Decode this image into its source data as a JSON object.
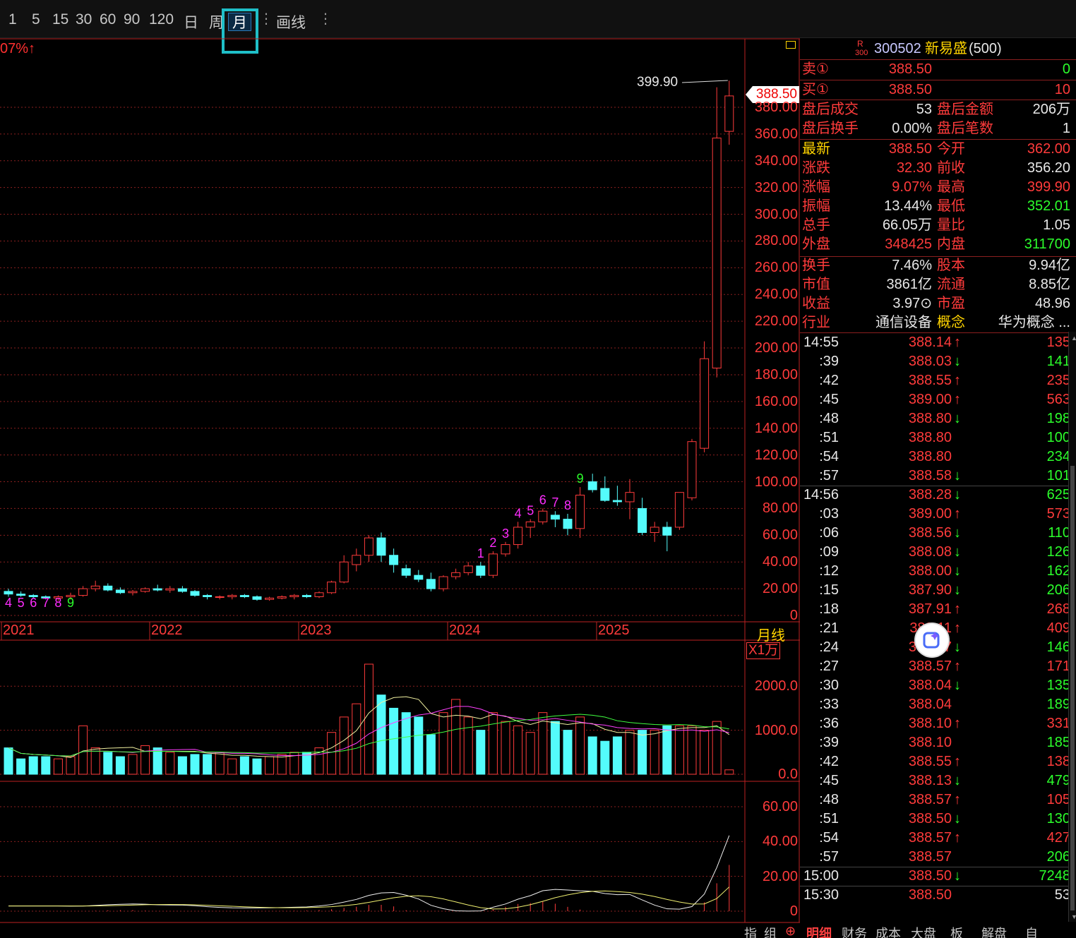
{
  "toolbar": {
    "periods": [
      "1",
      "5",
      "15",
      "30",
      "60",
      "90",
      "120",
      "日",
      "周",
      "月"
    ],
    "active": "月",
    "draw_label": "画线"
  },
  "chart_data": {
    "type": "candlestick",
    "period": "月线",
    "pct_label": "07%↑",
    "price_axis": [
      "380.00",
      "360.00",
      "340.00",
      "320.00",
      "300.00",
      "280.00",
      "260.00",
      "240.00",
      "220.00",
      "200.00",
      "180.00",
      "160.00",
      "140.00",
      "120.00",
      "100.00",
      "80.00",
      "60.00",
      "40.00",
      "20.00",
      "0"
    ],
    "ylim": [
      0,
      390
    ],
    "years": [
      "2021",
      "2022",
      "2023",
      "2024",
      "2025"
    ],
    "peak_label": "399.90",
    "last_price_tag": "388.50",
    "candles": [
      [
        18,
        20,
        14,
        16
      ],
      [
        16,
        18,
        14,
        15
      ],
      [
        15,
        16,
        13,
        14
      ],
      [
        14,
        15,
        12,
        13
      ],
      [
        13,
        15,
        11,
        14
      ],
      [
        14,
        17,
        12,
        15
      ],
      [
        15,
        22,
        14,
        20
      ],
      [
        20,
        26,
        18,
        22
      ],
      [
        22,
        24,
        18,
        19
      ],
      [
        19,
        21,
        16,
        17
      ],
      [
        17,
        19,
        15,
        18
      ],
      [
        18,
        21,
        17,
        20
      ],
      [
        20,
        23,
        18,
        19
      ],
      [
        19,
        22,
        17,
        20
      ],
      [
        20,
        22,
        17,
        18
      ],
      [
        18,
        19,
        14,
        15
      ],
      [
        15,
        16,
        12,
        14
      ],
      [
        14,
        15,
        12,
        14
      ],
      [
        14,
        16,
        12,
        15
      ],
      [
        15,
        16,
        13,
        14
      ],
      [
        14,
        15,
        11,
        12
      ],
      [
        12,
        14,
        11,
        13
      ],
      [
        13,
        15,
        12,
        14
      ],
      [
        14,
        16,
        12,
        15
      ],
      [
        15,
        16,
        13,
        14
      ],
      [
        14,
        18,
        13,
        17
      ],
      [
        17,
        26,
        16,
        25
      ],
      [
        25,
        45,
        24,
        40
      ],
      [
        38,
        50,
        33,
        45
      ],
      [
        45,
        60,
        40,
        58
      ],
      [
        58,
        62,
        40,
        45
      ],
      [
        45,
        50,
        32,
        38
      ],
      [
        35,
        38,
        28,
        30
      ],
      [
        30,
        34,
        25,
        27
      ],
      [
        27,
        32,
        18,
        20
      ],
      [
        20,
        30,
        18,
        29
      ],
      [
        29,
        35,
        27,
        32
      ],
      [
        32,
        40,
        30,
        37
      ],
      [
        37,
        40,
        28,
        30
      ],
      [
        30,
        48,
        28,
        46
      ],
      [
        46,
        55,
        44,
        53
      ],
      [
        53,
        70,
        50,
        66
      ],
      [
        66,
        72,
        58,
        70
      ],
      [
        70,
        80,
        68,
        78
      ],
      [
        75,
        78,
        66,
        72
      ],
      [
        72,
        76,
        60,
        65
      ],
      [
        65,
        96,
        58,
        90
      ],
      [
        100,
        106,
        92,
        94
      ],
      [
        95,
        104,
        85,
        86
      ],
      [
        86,
        97,
        82,
        85
      ],
      [
        85,
        102,
        72,
        92
      ],
      [
        80,
        88,
        60,
        62
      ],
      [
        62,
        70,
        55,
        66
      ],
      [
        66,
        70,
        48,
        60
      ],
      [
        66,
        92,
        64,
        92
      ],
      [
        88,
        132,
        86,
        130
      ],
      [
        125,
        205,
        122,
        192
      ],
      [
        185,
        395,
        178,
        357
      ],
      [
        362,
        399.9,
        352.01,
        388.5
      ]
    ],
    "td_labels": [
      {
        "i": 0,
        "t": "4",
        "c": "#ff2cff"
      },
      {
        "i": 1,
        "t": "5",
        "c": "#ff2cff"
      },
      {
        "i": 2,
        "t": "6",
        "c": "#ff2cff"
      },
      {
        "i": 3,
        "t": "7",
        "c": "#ff2cff"
      },
      {
        "i": 4,
        "t": "8",
        "c": "#ff2cff"
      },
      {
        "i": 5,
        "t": "9",
        "c": "#2cff2c"
      },
      {
        "i": 38,
        "t": "1",
        "c": "#ff2cff"
      },
      {
        "i": 39,
        "t": "2",
        "c": "#ff2cff"
      },
      {
        "i": 40,
        "t": "3",
        "c": "#ff2cff"
      },
      {
        "i": 41,
        "t": "4",
        "c": "#ff2cff"
      },
      {
        "i": 42,
        "t": "5",
        "c": "#ff2cff"
      },
      {
        "i": 43,
        "t": "6",
        "c": "#ff2cff"
      },
      {
        "i": 44,
        "t": "7",
        "c": "#ff2cff"
      },
      {
        "i": 45,
        "t": "8",
        "c": "#ff2cff"
      },
      {
        "i": 46,
        "t": "9",
        "c": "#2cff2c"
      }
    ],
    "volume_axis": [
      "2000.0",
      "1000.0",
      "0.0"
    ],
    "volume_unit": "X1万",
    "volume": [
      600,
      350,
      400,
      400,
      350,
      400,
      1100,
      600,
      500,
      400,
      450,
      650,
      600,
      500,
      400,
      450,
      450,
      500,
      350,
      400,
      350,
      400,
      450,
      500,
      500,
      600,
      950,
      1300,
      1600,
      2500,
      1800,
      1500,
      1400,
      1300,
      900,
      1400,
      1700,
      1300,
      1000,
      1400,
      1200,
      1100,
      950,
      1400,
      1200,
      1000,
      1300,
      850,
      750,
      850,
      1000,
      1000,
      1000,
      1100,
      1100,
      1100,
      1000,
      1200,
      100
    ],
    "indicator_axis": [
      "60.00",
      "40.00",
      "20.00",
      "0"
    ]
  },
  "quote": {
    "board_tag": "R",
    "board_tag2": "300",
    "code": "300502",
    "name": "新易盛",
    "index": "(500)",
    "sell_label": "卖①",
    "sell_price": "388.50",
    "sell_vol": "0",
    "buy_label": "买①",
    "buy_price": "388.50",
    "buy_vol": "10",
    "after_vol_label": "盘后成交",
    "after_vol": "53",
    "after_amt_label": "盘后金额",
    "after_amt": "206万",
    "after_turn_label": "盘后换手",
    "after_turn": "0.00%",
    "after_cnt_label": "盘后笔数",
    "after_cnt": "1",
    "stats": [
      {
        "l": "最新",
        "lc": "#ffd400",
        "v": "388.50",
        "vc": "#ff3b3b",
        "l2": "今开",
        "v2": "362.00",
        "v2c": "#ff3b3b"
      },
      {
        "l": "涨跌",
        "lc": "#ff3b3b",
        "v": "32.30",
        "vc": "#ff3b3b",
        "l2": "前收",
        "v2": "356.20",
        "v2c": "#e8e8e8"
      },
      {
        "l": "涨幅",
        "lc": "#ff3b3b",
        "v": "9.07%",
        "vc": "#ff3b3b",
        "l2": "最高",
        "v2": "399.90",
        "v2c": "#ff3b3b"
      },
      {
        "l": "振幅",
        "lc": "#ff3b3b",
        "v": "13.44%",
        "vc": "#e8e8e8",
        "l2": "最低",
        "v2": "352.01",
        "v2c": "#2cff2c"
      },
      {
        "l": "总手",
        "lc": "#ff3b3b",
        "v": "66.05万",
        "vc": "#e8e8e8",
        "l2": "量比",
        "v2": "1.05",
        "v2c": "#e8e8e8"
      },
      {
        "l": "外盘",
        "lc": "#ff3b3b",
        "v": "348425",
        "vc": "#ff3b3b",
        "l2": "内盘",
        "v2": "311700",
        "v2c": "#2cff2c"
      }
    ],
    "stats2": [
      {
        "l": "换手",
        "v": "7.46%",
        "l2": "股本",
        "v2": "9.94亿"
      },
      {
        "l": "市值",
        "v": "3861亿",
        "l2": "流通",
        "v2": "8.85亿"
      },
      {
        "l": "收益",
        "v": "3.97⊙",
        "l2": "市盈",
        "v2": "48.96"
      }
    ],
    "industry_label": "行业",
    "industry": "通信设备",
    "concept_label": "概念",
    "concept": "华为概念 ..."
  },
  "ticks": [
    {
      "t": "14:55",
      "p": "388.14",
      "d": "up",
      "v": "135"
    },
    {
      "t": ":39",
      "p": "388.03",
      "d": "down",
      "v": "141"
    },
    {
      "t": ":42",
      "p": "388.55",
      "d": "up",
      "v": "235"
    },
    {
      "t": ":45",
      "p": "389.00",
      "d": "up",
      "v": "563"
    },
    {
      "t": ":48",
      "p": "388.80",
      "d": "down",
      "v": "198"
    },
    {
      "t": ":51",
      "p": "388.80",
      "d": "",
      "v": "100"
    },
    {
      "t": ":54",
      "p": "388.80",
      "d": "",
      "v": "234"
    },
    {
      "t": ":57",
      "p": "388.58",
      "d": "down",
      "v": "101"
    },
    {
      "t": "14:56",
      "p": "388.28",
      "d": "down",
      "v": "625"
    },
    {
      "t": ":03",
      "p": "389.00",
      "d": "up",
      "v": "573"
    },
    {
      "t": ":06",
      "p": "388.56",
      "d": "down",
      "v": "110"
    },
    {
      "t": ":09",
      "p": "388.08",
      "d": "down",
      "v": "126"
    },
    {
      "t": ":12",
      "p": "388.00",
      "d": "down",
      "v": "162"
    },
    {
      "t": ":15",
      "p": "387.90",
      "d": "down",
      "v": "206"
    },
    {
      "t": ":18",
      "p": "387.91",
      "d": "up",
      "v": "268"
    },
    {
      "t": ":21",
      "p": "388.11",
      "d": "up",
      "v": "409"
    },
    {
      "t": ":24",
      "p": "387.97",
      "d": "down",
      "v": "146"
    },
    {
      "t": ":27",
      "p": "388.57",
      "d": "up",
      "v": "171"
    },
    {
      "t": ":30",
      "p": "388.04",
      "d": "down",
      "v": "135"
    },
    {
      "t": ":33",
      "p": "388.04",
      "d": "",
      "v": "189"
    },
    {
      "t": ":36",
      "p": "388.10",
      "d": "up",
      "v": "331"
    },
    {
      "t": ":39",
      "p": "388.10",
      "d": "",
      "v": "185"
    },
    {
      "t": ":42",
      "p": "388.55",
      "d": "up",
      "v": "138"
    },
    {
      "t": ":45",
      "p": "388.13",
      "d": "down",
      "v": "479"
    },
    {
      "t": ":48",
      "p": "388.57",
      "d": "up",
      "v": "105"
    },
    {
      "t": ":51",
      "p": "388.50",
      "d": "down",
      "v": "130"
    },
    {
      "t": ":54",
      "p": "388.57",
      "d": "up",
      "v": "427"
    },
    {
      "t": ":57",
      "p": "388.57",
      "d": "",
      "v": "206"
    },
    {
      "t": "15:00",
      "p": "388.50",
      "d": "down",
      "v": "7248"
    },
    {
      "t": "15:30",
      "p": "388.50",
      "d": "",
      "v": "53"
    }
  ],
  "bottom_tabs": [
    "指",
    "组",
    "明细",
    "财务",
    "成本",
    "大盘",
    "板",
    "解盘",
    "自"
  ],
  "bottom_active": "明细",
  "colors": {
    "up": "#ff3b3b",
    "down": "#54fcfc",
    "grid": "#8b1f1f",
    "text": "#e8e8e8",
    "yellow": "#ffd400",
    "green": "#2cff2c"
  }
}
